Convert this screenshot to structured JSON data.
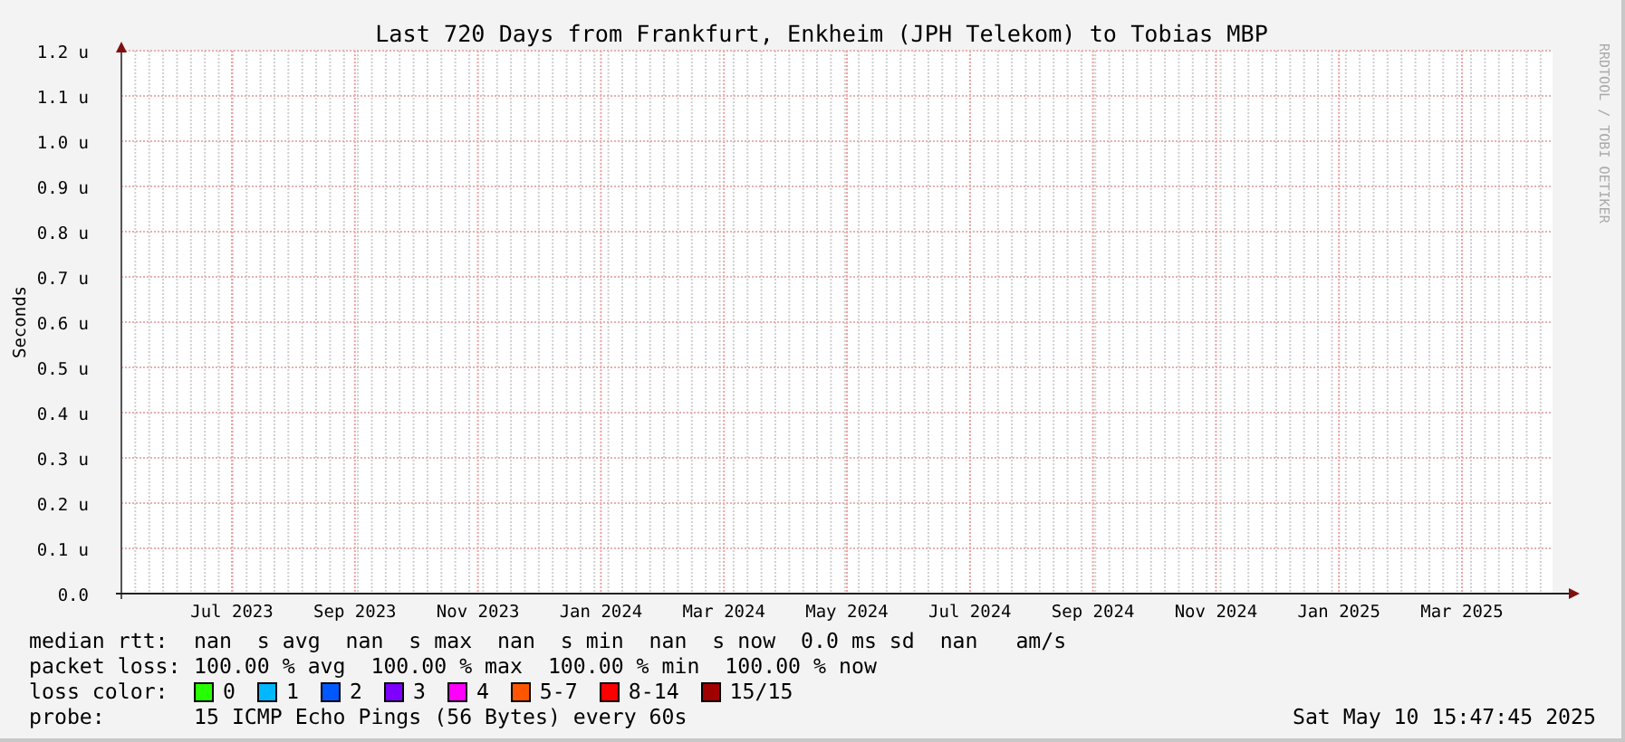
{
  "chart_data": {
    "type": "line",
    "title": "Last 720 Days from Frankfurt, Enkheim (JPH Telekom) to Tobias MBP",
    "ylabel": "Seconds",
    "grid": true,
    "ylim": [
      0,
      1.2
    ],
    "yticks": [
      {
        "value": 0,
        "label": "0.0"
      },
      {
        "value": 0.1,
        "label": "0.1 u"
      },
      {
        "value": 0.2,
        "label": "0.2 u"
      },
      {
        "value": 0.3,
        "label": "0.3 u"
      },
      {
        "value": 0.4,
        "label": "0.4 u"
      },
      {
        "value": 0.5,
        "label": "0.5 u"
      },
      {
        "value": 0.6,
        "label": "0.6 u"
      },
      {
        "value": 0.7,
        "label": "0.7 u"
      },
      {
        "value": 0.8,
        "label": "0.8 u"
      },
      {
        "value": 0.9,
        "label": "0.9 u"
      },
      {
        "value": 1.0,
        "label": "1.0 u"
      },
      {
        "value": 1.1,
        "label": "1.1 u"
      },
      {
        "value": 1.2,
        "label": "1.2 u"
      }
    ],
    "categories": [
      "Jul 2023",
      "Sep 2023",
      "Nov 2023",
      "Jan 2024",
      "Mar 2024",
      "May 2024",
      "Jul 2024",
      "Sep 2024",
      "Nov 2024",
      "Jan 2025",
      "Mar 2025"
    ]
  },
  "side_label": "RRDTOOL / TOBI OETIKER",
  "stats": [
    {
      "label": "median rtt:",
      "text": "nan  s avg  nan  s max  nan  s min  nan  s now  0.0 ms sd  nan   am/s"
    },
    {
      "label": "packet loss:",
      "text": "100.00 % avg  100.00 % max  100.00 % min  100.00 % now"
    }
  ],
  "loss_colors": {
    "label": "loss color:",
    "items": [
      {
        "label": "0",
        "color": "#26ff00"
      },
      {
        "label": "1",
        "color": "#00b8ff"
      },
      {
        "label": "2",
        "color": "#0059ff"
      },
      {
        "label": "3",
        "color": "#7e00ff"
      },
      {
        "label": "4",
        "color": "#ff00ff"
      },
      {
        "label": "5-7",
        "color": "#ff5500"
      },
      {
        "label": "8-14",
        "color": "#ff0000"
      },
      {
        "label": "15/15",
        "color": "#a10000"
      }
    ]
  },
  "probe": {
    "label": "probe:",
    "text": "15 ICMP Echo Pings (56 Bytes) every 60s"
  },
  "timestamp": "Sat May 10 15:47:45 2025"
}
